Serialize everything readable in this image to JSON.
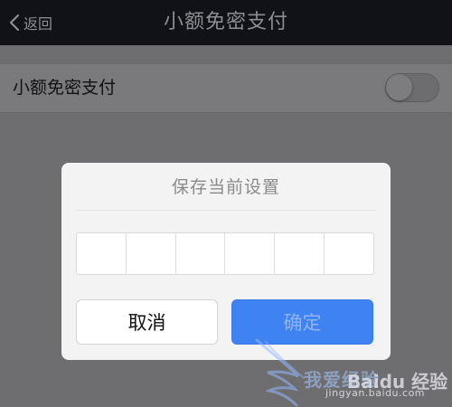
{
  "navbar": {
    "back_label": "返回",
    "title": "小额免密支付"
  },
  "settings": {
    "row_label": "小额免密支付",
    "toggle_on": false
  },
  "dialog": {
    "title": "保存当前设置",
    "pin_length": 6,
    "cancel_label": "取消",
    "confirm_label": "确定"
  },
  "watermark": {
    "text_cn": "我爱经验",
    "brand": "Baidu 经验",
    "url": "jingyan.baidu.com"
  },
  "colors": {
    "navbar_bg": "#111218",
    "overlay_bg": "#6e6e70",
    "confirm_button": "#3f82f1",
    "confirm_text_disabled": "#8fb4f5"
  }
}
